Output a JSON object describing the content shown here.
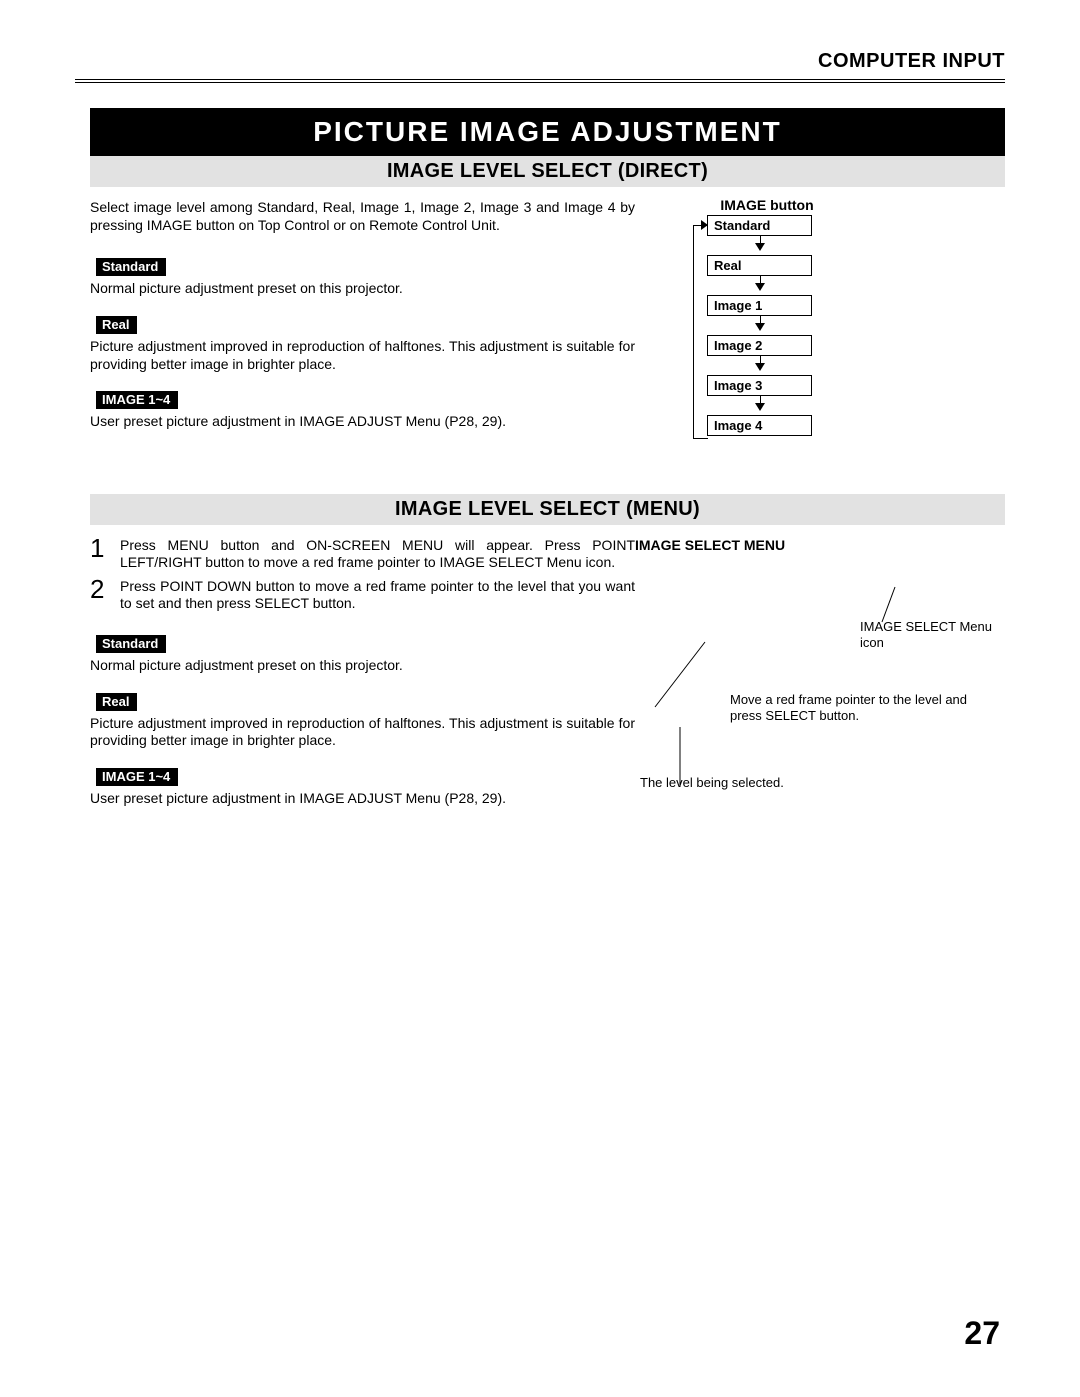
{
  "header": {
    "section": "COMPUTER INPUT"
  },
  "title": "PICTURE IMAGE ADJUSTMENT",
  "direct": {
    "heading": "IMAGE LEVEL SELECT (DIRECT)",
    "intro": "Select image level among Standard, Real, Image 1, Image 2, Image 3 and Image 4 by pressing IMAGE button on Top Control or on Remote Control Unit.",
    "standard_label": "Standard",
    "standard_text": "Normal picture adjustment preset on this projector.",
    "real_label": "Real",
    "real_text": "Picture adjustment improved in reproduction of halftones.  This adjustment is suitable for providing better image in brighter place.",
    "image14_label": "IMAGE 1~4",
    "image14_text": "User preset picture adjustment in IMAGE ADJUST Menu (P28, 29).",
    "button_title": "IMAGE button",
    "flow": [
      "Standard",
      "Real",
      "Image 1",
      "Image 2",
      "Image 3",
      "Image 4"
    ]
  },
  "menu": {
    "heading": "IMAGE LEVEL SELECT (MENU)",
    "step1_num": "1",
    "step1_text": "Press MENU button and ON-SCREEN MENU will appear.  Press POINT LEFT/RIGHT button to move a red frame pointer to IMAGE SELECT Menu icon.",
    "step2_num": "2",
    "step2_text": "Press POINT DOWN button to move a red frame pointer to the level that you want to set and then press SELECT button.",
    "standard_label": "Standard",
    "standard_text": "Normal picture adjustment preset on this projector.",
    "real_label": "Real",
    "real_text": "Picture adjustment improved in reproduction of halftones.  This adjustment is suitable for providing better image in brighter place.",
    "image14_label": "IMAGE 1~4",
    "image14_text": "User preset picture adjustment in IMAGE ADJUST Menu (P28, 29).",
    "right_heading": "IMAGE SELECT MENU",
    "annot_icon": "IMAGE SELECT Menu icon",
    "annot_move": "Move a red frame pointer to the level and press SELECT button.",
    "annot_level": "The level being selected."
  },
  "page_number": "27"
}
